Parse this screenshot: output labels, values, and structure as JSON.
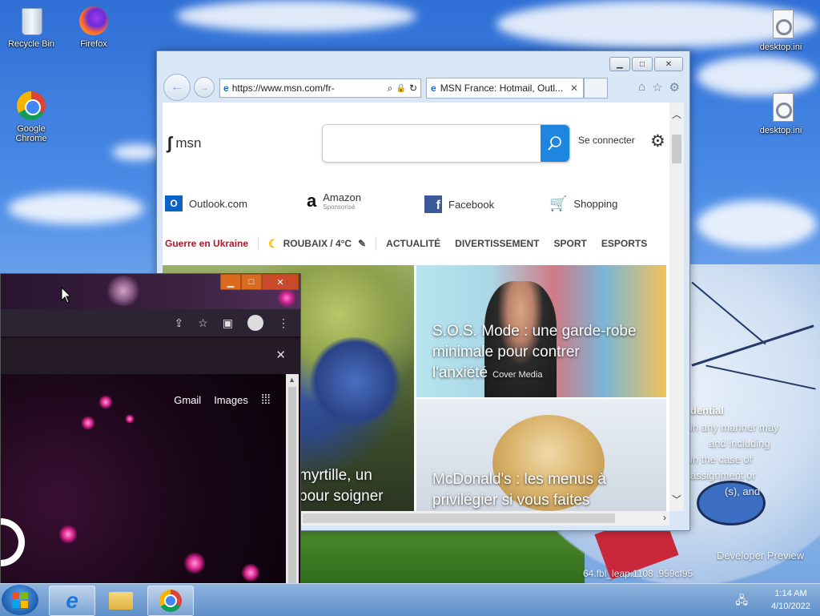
{
  "desktop": {
    "icons": [
      {
        "label": "Recycle Bin"
      },
      {
        "label": "Firefox"
      },
      {
        "label": "Google Chrome"
      },
      {
        "label": "desktop.ini"
      },
      {
        "label": "desktop.ini"
      }
    ],
    "wallpaper_text": {
      "heading": "dential",
      "lines": [
        "in any manner may",
        "and including",
        "in the case of",
        "assignment or",
        "(s), and"
      ],
      "build": "Developer Preview",
      "build_id": "64.fbl_leap.1108 .959cf95"
    }
  },
  "ie": {
    "address": "https://www.msn.com/fr-",
    "tab_title": "MSN France: Hotmail, Outl...",
    "page": {
      "logo": "msn",
      "search_placeholder": "",
      "signin": "Se connecter",
      "quicklinks": [
        {
          "label": "Outlook.com",
          "sub": ""
        },
        {
          "label": "Amazon",
          "sub": "Sponsorisé"
        },
        {
          "label": "Facebook",
          "sub": ""
        },
        {
          "label": "Shopping",
          "sub": ""
        }
      ],
      "hot_topic": "Guerre en Ukraine",
      "weather": "ROUBAIX / 4°C",
      "categories": [
        "ACTUALITÉ",
        "DIVERTISSEMENT",
        "SPORT",
        "ESPORTS"
      ],
      "stories": [
        {
          "title_l1": "myrtille, un",
          "title_l2": "pour soigner",
          "source": ""
        },
        {
          "title_l1": "S.O.S. Mode : une garde-robe",
          "title_l2": "minimale pour contrer",
          "title_l3": "l'anxiété",
          "source": "Cover Media"
        },
        {
          "title_l1": "McDonald's : les menus à",
          "title_l2": "privilégier si vous faites",
          "source": ""
        }
      ]
    }
  },
  "chrome": {
    "links": [
      "Gmail",
      "Images"
    ]
  },
  "taskbar": {
    "time": "1:14 AM",
    "date": "4/10/2022"
  },
  "colors": {
    "msn_blue": "#1f86e0",
    "hot_red": "#b0192b"
  }
}
